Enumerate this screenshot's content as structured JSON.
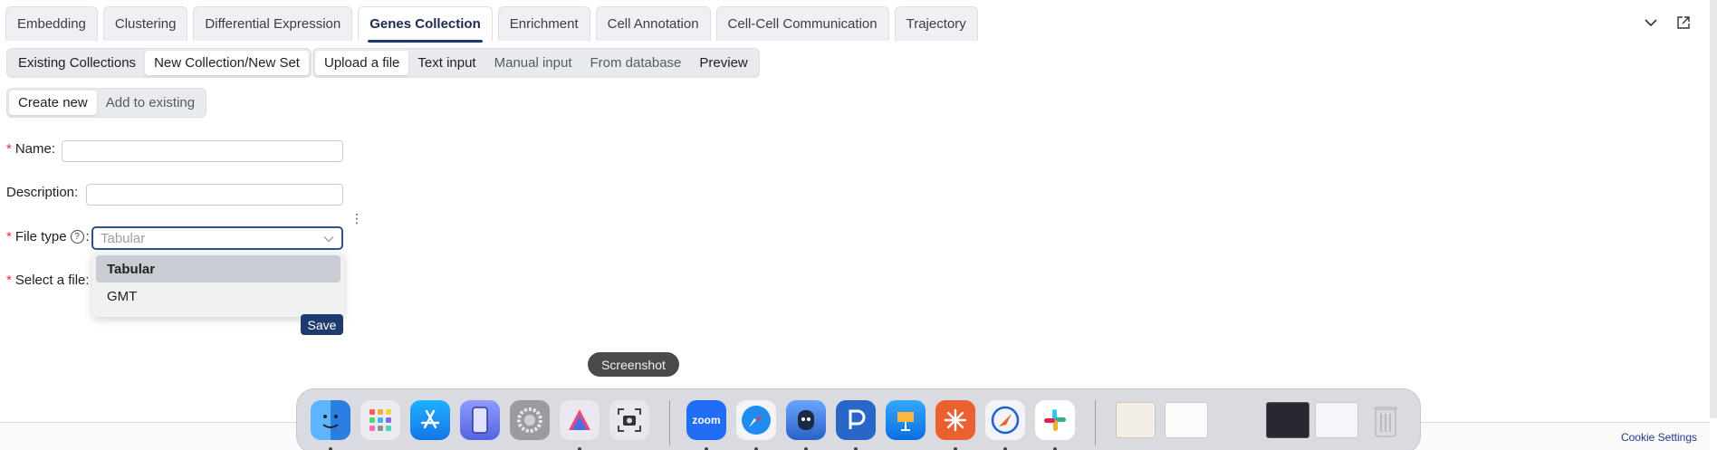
{
  "tabs": [
    {
      "label": "Embedding"
    },
    {
      "label": "Clustering"
    },
    {
      "label": "Differential Expression"
    },
    {
      "label": "Genes Collection"
    },
    {
      "label": "Enrichment"
    },
    {
      "label": "Cell Annotation"
    },
    {
      "label": "Cell-Cell Communication"
    },
    {
      "label": "Trajectory"
    }
  ],
  "active_tab": "Genes Collection",
  "collection_mode": {
    "items": [
      {
        "label": "Existing Collections"
      },
      {
        "label": "New Collection/New Set"
      }
    ],
    "selected": "Existing Collections"
  },
  "input_method": {
    "items": [
      {
        "label": "Upload a file"
      },
      {
        "label": "Text input"
      },
      {
        "label": "Manual input"
      },
      {
        "label": "From database"
      },
      {
        "label": "Preview"
      }
    ],
    "selected": "Upload a file"
  },
  "create_mode": {
    "items": [
      {
        "label": "Create new"
      },
      {
        "label": "Add to existing"
      }
    ],
    "selected": "Create new"
  },
  "form": {
    "name_label": "Name",
    "name_value": "",
    "description_label": "Description",
    "description_value": "",
    "file_type_label": "File type",
    "file_type_placeholder": "Tabular",
    "file_type_options": [
      {
        "label": "Tabular"
      },
      {
        "label": "GMT"
      }
    ],
    "file_type_highlighted": "Tabular",
    "select_file_label": "Select a file",
    "colon": ":",
    "required_mark": "*",
    "save_label": "Save"
  },
  "footer": {
    "cookie_settings": "Cookie Settings"
  },
  "tooltip": {
    "text": "Screenshot"
  },
  "dock": {
    "apps": [
      {
        "name": "Finder",
        "icon": "finder-icon",
        "color": "#2f8cf0"
      },
      {
        "name": "Launchpad",
        "icon": "launchpad-icon",
        "color": "#e8e8ec"
      },
      {
        "name": "App Store",
        "icon": "app-store-icon",
        "color": "#1a8df5"
      },
      {
        "name": "Simulator",
        "icon": "simulator-icon",
        "color": "#6a79e8"
      },
      {
        "name": "System Settings",
        "icon": "settings-icon",
        "color": "#8e8e93"
      },
      {
        "name": "Affinity",
        "icon": "affinity-icon",
        "color": "#e9e6ef"
      },
      {
        "name": "Screenshot",
        "icon": "screenshot-icon",
        "color": "#e6e6ea"
      },
      {
        "name": "Zoom",
        "icon": "zoom-icon",
        "color": "#1f6ef5",
        "label": "zoom"
      },
      {
        "name": "Safari",
        "icon": "safari-icon",
        "color": "#1e8cf0"
      },
      {
        "name": "Ollama",
        "icon": "ollama-icon",
        "color": "#3c7bd8"
      },
      {
        "name": "PyCharm",
        "icon": "pycharm-icon",
        "color": "#2867c8"
      },
      {
        "name": "Keynote",
        "icon": "keynote-icon",
        "color": "#1c8ef5"
      },
      {
        "name": "Claude",
        "icon": "claude-icon",
        "color": "#e9612e"
      },
      {
        "name": "Navigator",
        "icon": "navigator-icon",
        "color": "#f1f1f4"
      },
      {
        "name": "Slack",
        "icon": "slack-icon",
        "color": "#ffffff"
      }
    ]
  }
}
